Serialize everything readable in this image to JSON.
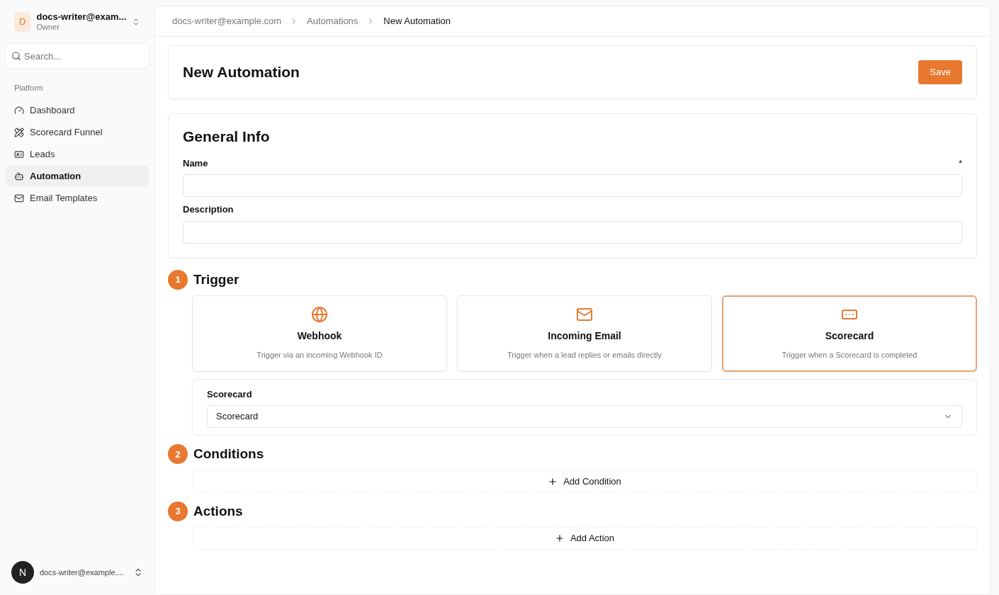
{
  "sidebar": {
    "account": {
      "initial": "D",
      "name": "docs-writer@exam...",
      "role": "Owner"
    },
    "search": {
      "placeholder": "Search..."
    },
    "section_label": "Platform",
    "items": [
      {
        "label": "Dashboard",
        "kind": "gauge",
        "selected": false
      },
      {
        "label": "Scorecard Funnel",
        "kind": "ruler",
        "selected": false
      },
      {
        "label": "Leads",
        "kind": "idcard",
        "selected": false
      },
      {
        "label": "Automation",
        "kind": "bot",
        "selected": true
      },
      {
        "label": "Email Templates",
        "kind": "mail",
        "selected": false
      }
    ],
    "footer_user": {
      "initial": "N",
      "name": "docs-writer@example...."
    }
  },
  "breadcrumb": [
    {
      "label": "docs-writer@example.com",
      "current": false
    },
    {
      "label": "Automations",
      "current": false
    },
    {
      "label": "New Automation",
      "current": true
    }
  ],
  "page": {
    "title": "New Automation",
    "save_button": "Save"
  },
  "general_info": {
    "title": "General Info",
    "fields": [
      {
        "label": "Name",
        "required_mark": "*"
      },
      {
        "label": "Description"
      }
    ]
  },
  "trigger": {
    "number": "1",
    "title": "Trigger",
    "options": [
      {
        "kind": "globe",
        "title": "Webhook",
        "description": "Trigger via an incoming Webhook ID",
        "selected": false
      },
      {
        "kind": "mail",
        "title": "Incoming Email",
        "description": "Trigger when a lead replies or emails directly",
        "selected": false
      },
      {
        "kind": "ellipsis",
        "title": "Scorecard",
        "description": "Trigger when a Scorecard is completed",
        "selected": true
      }
    ],
    "select": {
      "label": "Scorecard",
      "value": "Scorecard"
    }
  },
  "conditions": {
    "number": "2",
    "title": "Conditions",
    "add_button": "Add Condition"
  },
  "actions": {
    "number": "3",
    "title": "Actions",
    "add_button": "Add Action"
  }
}
